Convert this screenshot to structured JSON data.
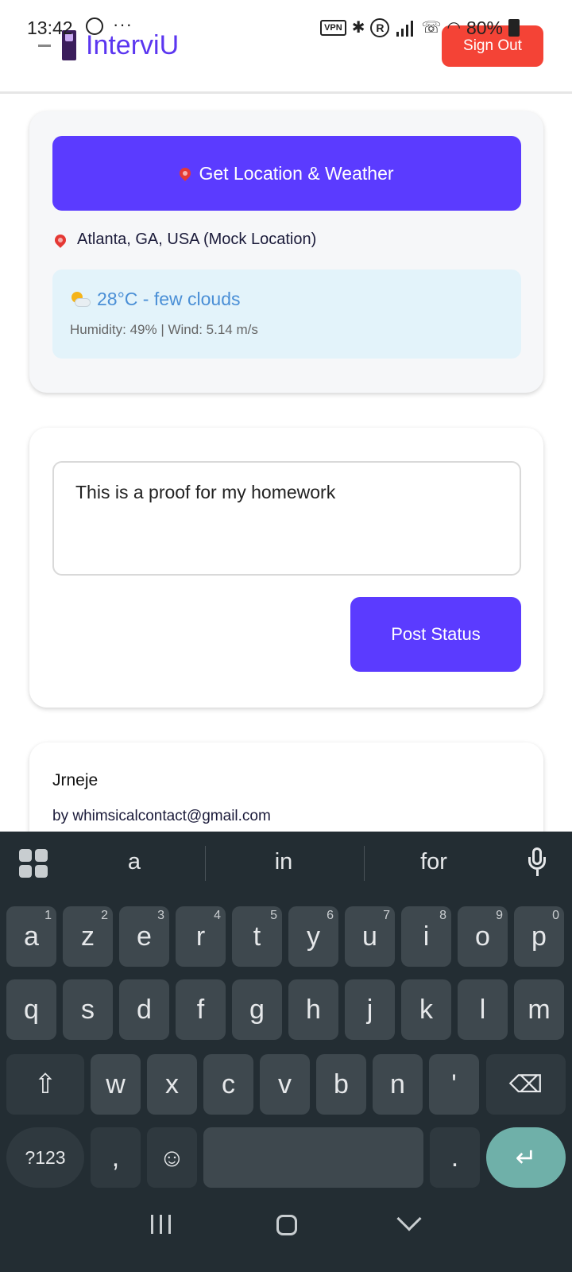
{
  "status_bar": {
    "time": "13:42",
    "more": "···",
    "vpn": "VPN",
    "battery": "80%"
  },
  "header": {
    "app_name": "InterviU",
    "sign_out_label": "Sign Out"
  },
  "location_card": {
    "button_label": "Get Location & Weather",
    "location_text": "Atlanta, GA, USA (Mock Location)",
    "weather_main": "28°C - few clouds",
    "weather_details": "Humidity: 49% | Wind: 5.14 m/s"
  },
  "status_card": {
    "input_value": "This is a proof for my homework",
    "post_button_label": "Post Status"
  },
  "post_card": {
    "title": "Jrneje",
    "author": "by whimsicalcontact@gmail.com"
  },
  "keyboard": {
    "suggestions": [
      "a",
      "in",
      "for"
    ],
    "row1": [
      {
        "key": "a",
        "hint": "1"
      },
      {
        "key": "z",
        "hint": "2"
      },
      {
        "key": "e",
        "hint": "3"
      },
      {
        "key": "r",
        "hint": "4"
      },
      {
        "key": "t",
        "hint": "5"
      },
      {
        "key": "y",
        "hint": "6"
      },
      {
        "key": "u",
        "hint": "7"
      },
      {
        "key": "i",
        "hint": "8"
      },
      {
        "key": "o",
        "hint": "9"
      },
      {
        "key": "p",
        "hint": "0"
      }
    ],
    "row2": [
      "q",
      "s",
      "d",
      "f",
      "g",
      "h",
      "j",
      "k",
      "l",
      "m"
    ],
    "row3": [
      "w",
      "x",
      "c",
      "v",
      "b",
      "n",
      "'"
    ],
    "symbols_label": "?123",
    "comma": ",",
    "period": "."
  },
  "colors": {
    "accent": "#5b3bff",
    "sign_out": "#f44336",
    "weather_bg": "#e3f3fa",
    "keyboard_bg": "#232d33"
  }
}
